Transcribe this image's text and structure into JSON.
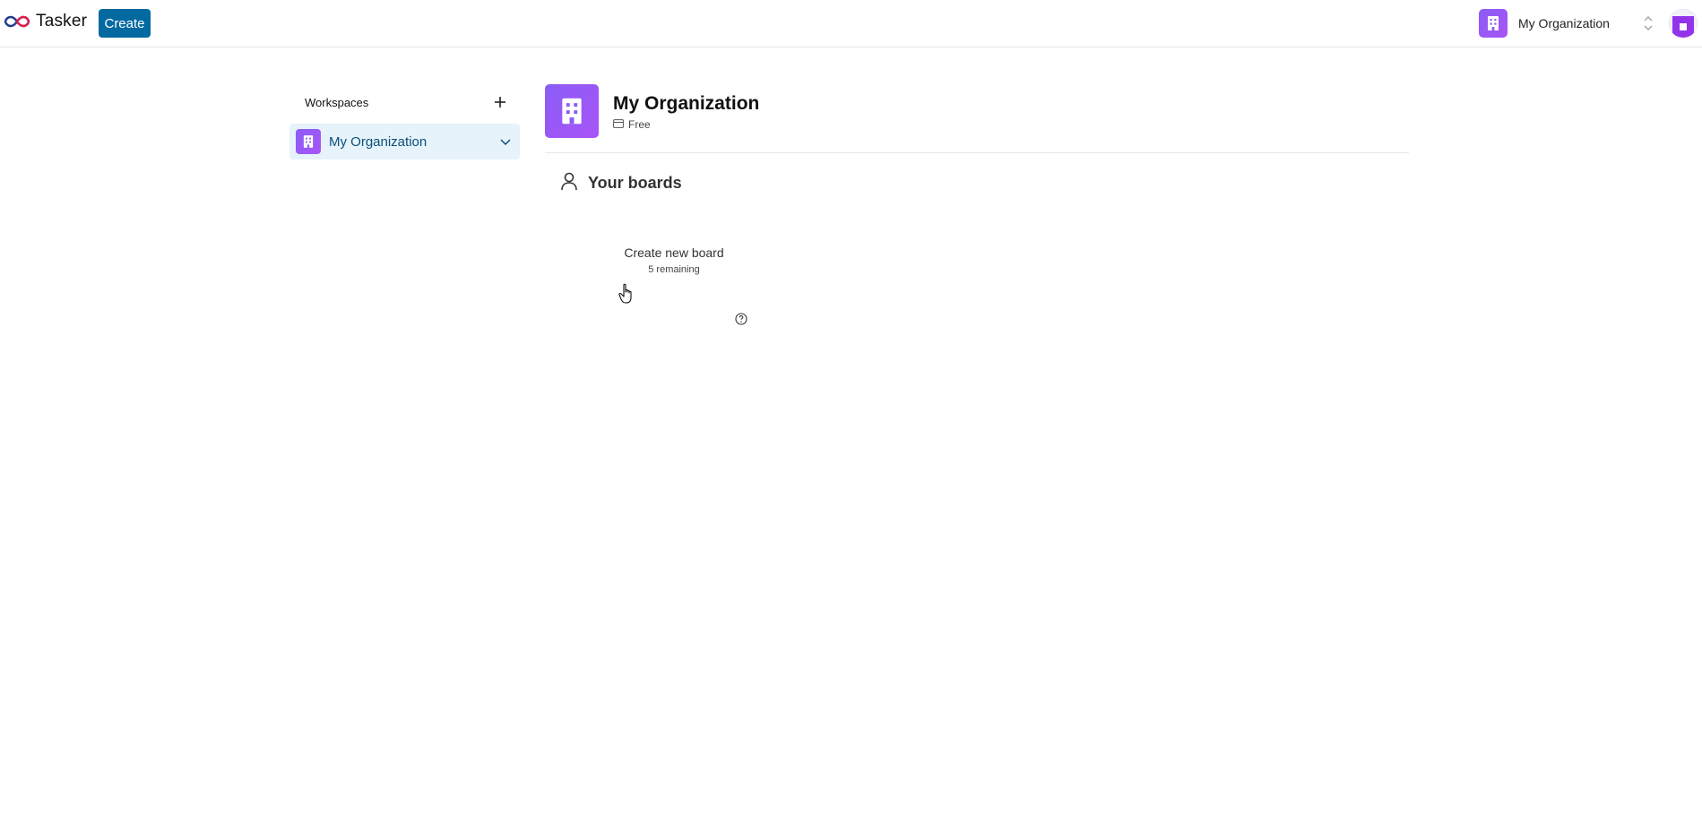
{
  "topbar": {
    "logo_text": "Tasker",
    "logo_icon": "infinity-logo-icon",
    "create_label": "Create",
    "org_switcher": {
      "name": "My Organization",
      "icon": "building-icon"
    },
    "user_avatar_icon": "user-avatar-icon"
  },
  "sidebar": {
    "title": "Workspaces",
    "add_icon": "plus-icon",
    "items": [
      {
        "label": "My Organization",
        "icon": "building-icon",
        "expanded": true
      }
    ]
  },
  "main": {
    "org_name": "My Organization",
    "plan": "Free",
    "plan_icon": "credit-card-icon",
    "section_title": "Your boards",
    "section_icon": "user-icon",
    "create_board": {
      "title": "Create new board",
      "remaining": "5 remaining"
    }
  },
  "colors": {
    "primary": "#0369a1",
    "org_avatar": "#8b5cf6",
    "active_item_bg": "#e6f3fb",
    "active_item_text": "#0b4f78"
  }
}
